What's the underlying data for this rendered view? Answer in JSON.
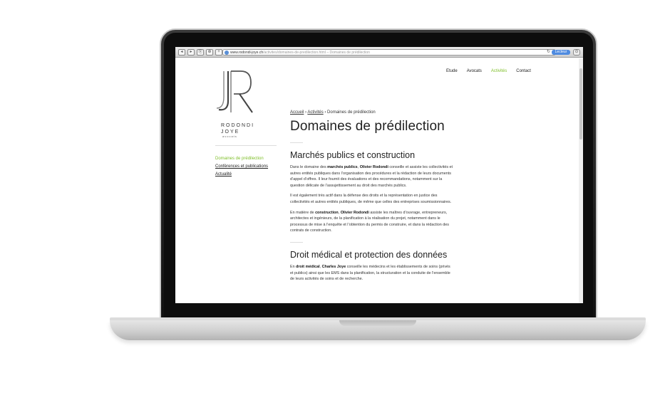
{
  "browser": {
    "url_main": "www.rodondi-joye.ch",
    "url_rest": "/activites/domaines-de-predilection.html – Domaines de prédilection",
    "reader_label": "Lecteur",
    "buttons": [
      "◂",
      "▸",
      "⎘",
      "⊕",
      "+"
    ]
  },
  "nav": {
    "items": [
      {
        "label": "Etude",
        "active": false
      },
      {
        "label": "Avocats",
        "active": false
      },
      {
        "label": "Activités",
        "active": true
      },
      {
        "label": "Contact",
        "active": false
      }
    ]
  },
  "logo": {
    "name_line1": "RODONDI",
    "name_line2": "JOYE",
    "sub": "avocats"
  },
  "sidebar": {
    "items": [
      {
        "label": "Domaines de prédilection",
        "active": true
      },
      {
        "label": "Conférences et publications",
        "active": false
      },
      {
        "label": "Actualité",
        "active": false
      }
    ]
  },
  "breadcrumb": {
    "home": "Accueil",
    "section": "Activités",
    "current": "Domaines de prédilection"
  },
  "page": {
    "title": "Domaines de prédilection",
    "sections": [
      {
        "heading": "Marchés publics et construction",
        "paragraphs": [
          {
            "pre": "Dans le domaine des ",
            "b1": "marchés publics",
            "mid": ", ",
            "b2": "Olivier Rodondi",
            "post": " conseille et assiste les collectivités et autres entités publiques dans l’organisation des procédures et la rédaction de leurs documents d’appel d’offres. Il leur fournit des évaluations et des recommandations, notamment sur la question délicate de l’assujettissement au droit des marchés publics."
          },
          {
            "pre": "Il est également très actif dans la défense des droits et la représentation en justice des collectivités et autres entités publiques, de même que celles des entreprises soumissionnaires.",
            "b1": "",
            "mid": "",
            "b2": "",
            "post": ""
          },
          {
            "pre": "En matière de ",
            "b1": "construction",
            "mid": ", ",
            "b2": "Olivier Rodondi",
            "post": " assiste les maîtres d’ouvrage, entrepreneurs, architectes et ingénieurs, de la planification à la réalisation du projet, notamment dans le processus de mise à l’enquête et l’obtention du permis de construire, et dans la rédaction des contrats de construction."
          }
        ]
      },
      {
        "heading": "Droit médical et protection des données",
        "paragraphs": [
          {
            "pre": "En ",
            "b1": "droit médical",
            "mid": ", ",
            "b2": "Charles Joye",
            "post": " conseille les médecins et les établissements de soins (privés et publics) ainsi que les EMS dans la planification, la structuration et la conduite de l’ensemble de leurs activités de soins et de recherche."
          }
        ]
      }
    ]
  },
  "colors": {
    "accent": "#7fbf2a",
    "reader": "#4f8be0"
  }
}
